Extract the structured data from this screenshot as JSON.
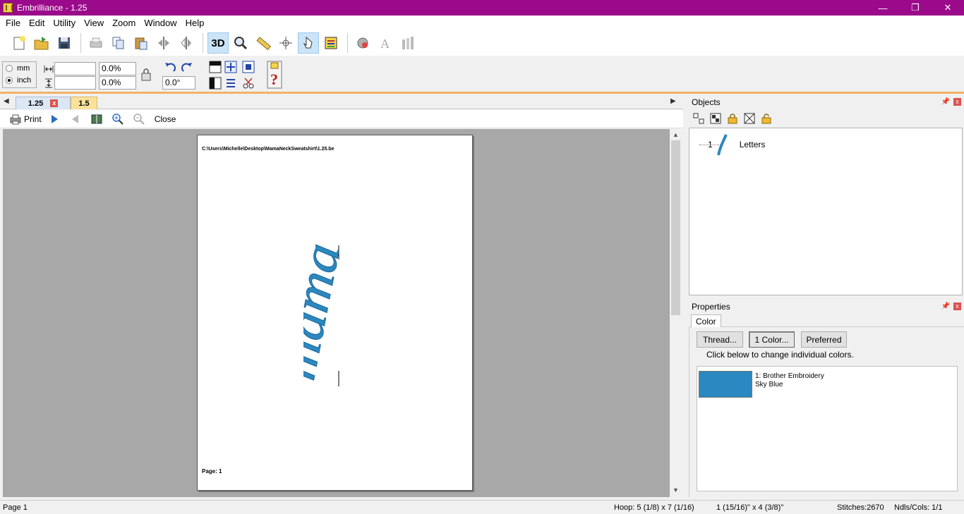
{
  "titlebar": {
    "title": "Embrilliance -  1.25",
    "minimize": "—",
    "maximize": "❐",
    "close": "✕"
  },
  "menu": [
    "File",
    "Edit",
    "Utility",
    "View",
    "Zoom",
    "Window",
    "Help"
  ],
  "toolbar2": {
    "unit_mm": "mm",
    "unit_inch": "inch",
    "width_value": "",
    "height_value": "",
    "width_pct": "0.0%",
    "height_pct": "0.0%",
    "rotation": "0.0°"
  },
  "toolbar1": {
    "three_d_label": "3D"
  },
  "doc_tabs": {
    "tab1": "1.25",
    "tab2": "1.5",
    "close_glyph": "x"
  },
  "preview_toolbar": {
    "print": "Print",
    "close": "Close"
  },
  "page": {
    "path": "C:\\Users\\Michelle\\Desktop\\MamaNeckSweatshirt\\1.25.be",
    "page_label": "Page: 1",
    "design_text": "mama"
  },
  "objects": {
    "header": "Objects",
    "item_number": "1",
    "item_label": "Letters"
  },
  "properties": {
    "header": "Properties",
    "tab": "Color",
    "thread_btn": "Thread...",
    "color_btn": "1 Color...",
    "preferred_btn": "Preferred",
    "hint": "Click below to change individual colors.",
    "color_line1": "1: Brother Embroidery",
    "color_line2": "Sky Blue",
    "swatch_color": "#2b88c0"
  },
  "status": {
    "page": "Page 1",
    "hoop": "Hoop: 5 (1/8) x 7 (1/16)",
    "size": "1 (15/16)\" x 4 (3/8)\"",
    "stitches": "Stitches:2670",
    "ndls": "Ndls/Cols: 1/1"
  },
  "colors": {
    "titlebar": "#9a0a8a",
    "thread": "#2b88c0"
  }
}
